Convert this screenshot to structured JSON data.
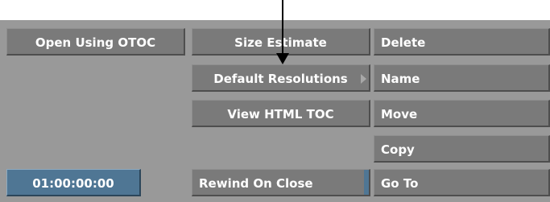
{
  "buttons": {
    "open_using_otoc": "Open Using OTOC",
    "size_estimate": "Size Estimate",
    "delete": "Delete",
    "default_resolutions": "Default Resolutions",
    "name": "Name",
    "view_html_toc": "View HTML TOC",
    "move": "Move",
    "copy": "Copy",
    "rewind_on_close": "Rewind On Close",
    "go_to": "Go To"
  },
  "timecode": {
    "value": "01:00:00:00"
  },
  "icons": {
    "submenu": "chevron-right-icon",
    "callout": "arrow-down-icon"
  },
  "colors": {
    "panel_bg": "#999999",
    "button_bg": "#7a7a7a",
    "timecode_bg": "#4f7694",
    "text": "#ffffff"
  }
}
